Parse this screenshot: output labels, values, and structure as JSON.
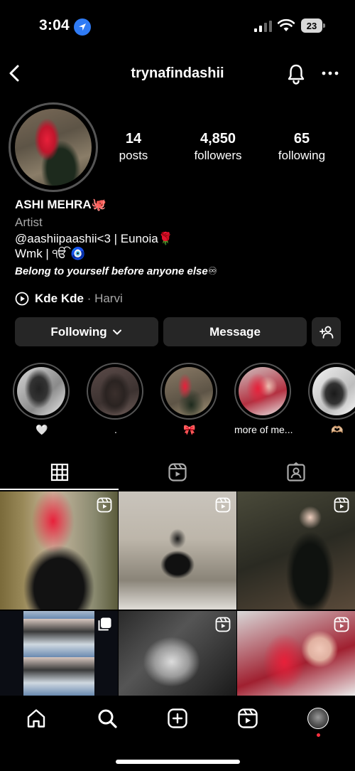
{
  "status_bar": {
    "time": "3:04",
    "battery": "23"
  },
  "header": {
    "username": "trynafindashii"
  },
  "profile": {
    "stats": [
      {
        "number": "14",
        "label": "posts"
      },
      {
        "number": "4,850",
        "label": "followers"
      },
      {
        "number": "65",
        "label": "following"
      }
    ],
    "name": "ASHI MEHRA🐙",
    "category": "Artist",
    "bio_lines": [
      "@aashiipaashii<3 | Eunoia🌹",
      "Wmk | ੴ 🧿",
      "Belong to yourself before anyone else♾"
    ],
    "music": {
      "title": "Kde Kde",
      "separator": " · ",
      "artist": "Harvi"
    }
  },
  "actions": {
    "following_label": "Following",
    "message_label": "Message"
  },
  "highlights": [
    {
      "label": "🤍"
    },
    {
      "label": "."
    },
    {
      "label": "🎀"
    },
    {
      "label": "more of me..."
    },
    {
      "label": "🫶🏼"
    }
  ],
  "colors": {
    "background": "#000000",
    "button_bg": "#262626",
    "secondary_text": "#a8a8a8",
    "notification_dot": "#ff3040"
  }
}
